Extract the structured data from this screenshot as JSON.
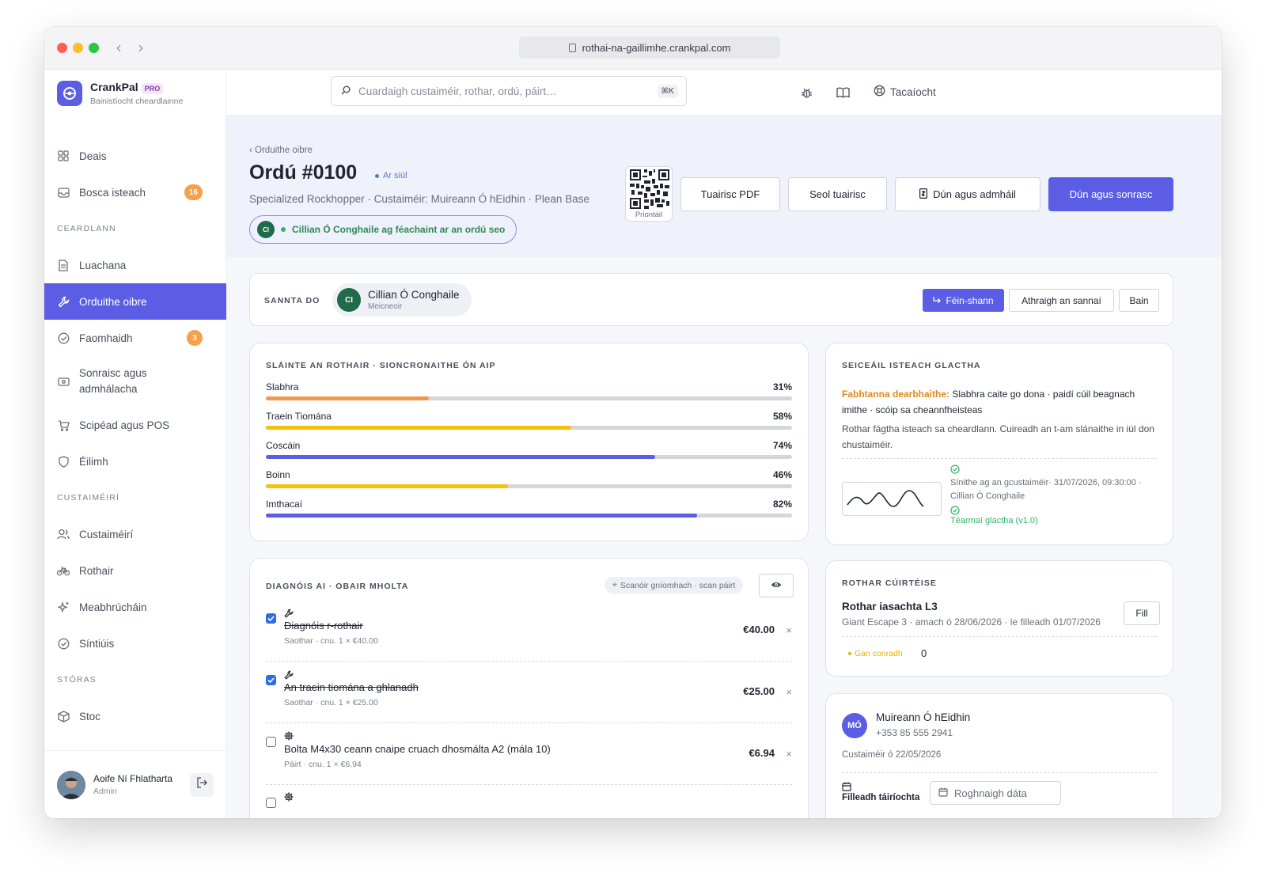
{
  "browser": {
    "url": "rothai-na-gaillimhe.crankpal.com"
  },
  "brand": {
    "name": "CrankPal",
    "badge": "PRO",
    "subtitle": "Bainistíocht cheardlainne"
  },
  "search": {
    "placeholder": "Cuardaigh custaiméir, rothar, ordú, páirt…",
    "shortcut": "⌘K"
  },
  "topbar": {
    "support_label": "Tacaíocht"
  },
  "sidebar": {
    "items": [
      {
        "label": "Deais",
        "icon": "grid-icon"
      },
      {
        "label": "Bosca isteach",
        "icon": "inbox-icon",
        "badge": "16"
      }
    ],
    "section_workshop": "CEARDLANN",
    "workshop_items": [
      {
        "label": "Luachana",
        "icon": "document-icon"
      },
      {
        "label": "Orduithe oibre",
        "icon": "wrench-icon",
        "active": true
      },
      {
        "label": "Faomhaidh",
        "icon": "check-circle-icon",
        "badge": "3"
      },
      {
        "label": "Sonraisc agus admhálacha",
        "icon": "money-icon"
      },
      {
        "label": "Scipéad agus POS",
        "icon": "cart-icon"
      },
      {
        "label": "Éilimh",
        "icon": "shield-icon"
      }
    ],
    "section_customers": "CUSTAIMÉIRÍ",
    "customer_items": [
      {
        "label": "Custaiméirí",
        "icon": "users-icon"
      },
      {
        "label": "Rothair",
        "icon": "bike-icon"
      },
      {
        "label": "Meabhrúcháin",
        "icon": "sparkle-icon"
      },
      {
        "label": "Síntiúis",
        "icon": "check-circle-icon"
      }
    ],
    "section_store": "STÓRAS",
    "store_items": [
      {
        "label": "Stoc",
        "icon": "box-icon"
      }
    ],
    "user": {
      "name": "Aoife Ní Fhlatharta",
      "role": "Admin"
    }
  },
  "order": {
    "breadcrumb": "‹ Orduithe oibre",
    "title": "Ordú #0100",
    "status": "Ar siúl",
    "subtitle": "Specialized Rockhopper · Custaiméir: Muireann Ó hEidhin · Plean Base",
    "viewer_initials": "CI",
    "viewer_text": "Cillian Ó Conghaile ag féachaint ar an ordú seo",
    "qr_label": "Priontáil",
    "buttons": {
      "pdf": "Tuairisc PDF",
      "send": "Seol tuairisc",
      "close_receipt": "Dún agus admháil",
      "close_invoice": "Dún agus sonrasc"
    }
  },
  "assign": {
    "label": "SANNTA DO",
    "initials": "CI",
    "name": "Cillian Ó Conghaile",
    "role": "Meicneoir",
    "self_assign": "Féin-shann",
    "change": "Athraigh an sannaí",
    "remove": "Bain"
  },
  "health": {
    "label": "SLÁINTE AN ROTHAIR · SIONCRONAITHE ÓN AIP",
    "bars": [
      {
        "name": "Slabhra",
        "pct": "31%",
        "value": 31,
        "color": "#ef9a4a"
      },
      {
        "name": "Traein Tiomána",
        "pct": "58%",
        "value": 58,
        "color": "#f4c20d"
      },
      {
        "name": "Coscáin",
        "pct": "74%",
        "value": 74,
        "color": "#5b5ee5"
      },
      {
        "name": "Boinn",
        "pct": "46%",
        "value": 46,
        "color": "#f4c20d"
      },
      {
        "name": "Imthacaí",
        "pct": "82%",
        "value": 82,
        "color": "#5b5ee5"
      }
    ]
  },
  "checkin": {
    "label": "SEICEÁIL ISTEACH GLACTHA",
    "defects_label": "Fabhtanna dearbhaithe:",
    "defects_text": "Slabhra caite go dona · paidí cúil beagnach imithe · scóip sa cheannfheisteas",
    "note": "Rothar fágtha isteach sa cheardlann. Cuireadh an t-am slánaithe in iúl don chustaiméir.",
    "signed": "Sínithe ag an gcustaiméir· 31/07/2026, 09:30:00 · Cillian Ó Conghaile",
    "terms": "Téarmaí glactha (v1.0)"
  },
  "diagnosis": {
    "label": "DIAGNÓIS AI · OBAIR MHOLTA",
    "scanner": "Scanóir gníomhach · scan páirt",
    "items": [
      {
        "title": "Diagnóis r-rothair",
        "meta": "Saothar · cnu. 1 × €40.00",
        "price": "€40.00",
        "x": "×",
        "icon": "wrench-icon"
      },
      {
        "title": "An traein tiomána a ghlanadh",
        "meta": "Saothar · cnu. 1 × €25.00",
        "price": "€25.00",
        "x": "×",
        "icon": "wrench-icon"
      },
      {
        "title": "Bolta M4x30 ceann cnaipe cruach dhosmálta A2 (mála 10)",
        "meta": "Páirt · cnu. 1 × €6.94",
        "price": "€6.94",
        "x": "×",
        "icon": "gear-icon"
      }
    ]
  },
  "loaner": {
    "label": "ROTHAR CÚIRTÉISE",
    "title": "Rothar iasachta L3",
    "details": "Giant Escape 3 · amach ó 28/06/2026 · le filleadh 01/07/2026",
    "return_btn": "Fill",
    "contract": "Gan conradh",
    "count": "0"
  },
  "customer": {
    "initials": "MÓ",
    "name": "Muireann Ó hEidhin",
    "phone": "+353 85 555 2941",
    "since": "Custaiméir ó 22/05/2026",
    "return_label": "Filleadh táiríochta",
    "date_placeholder": "Roghnaigh dáta"
  }
}
